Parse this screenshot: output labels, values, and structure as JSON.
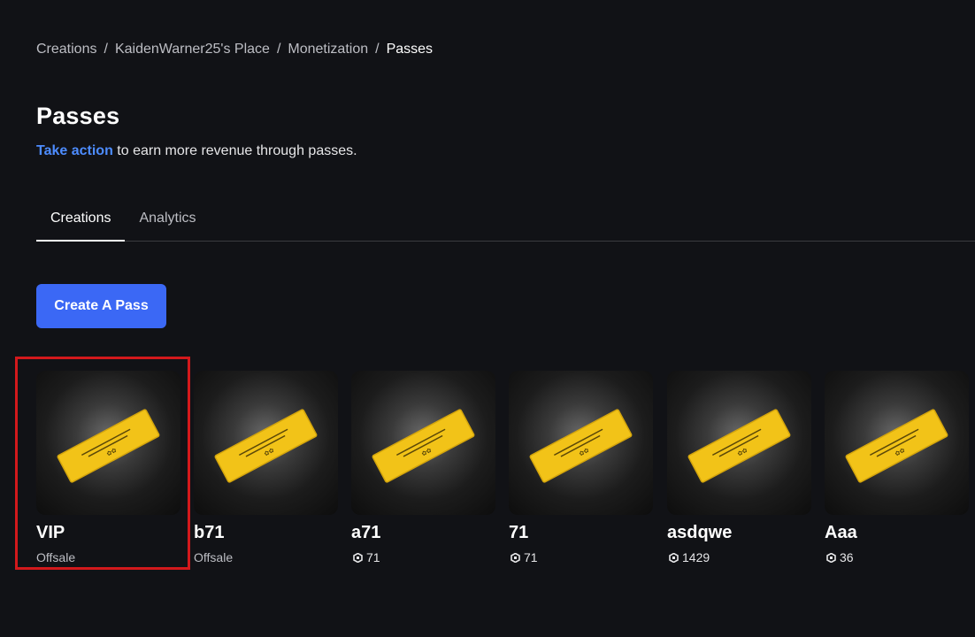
{
  "breadcrumb": {
    "items": [
      "Creations",
      "KaidenWarner25's Place",
      "Monetization"
    ],
    "current": "Passes",
    "separator": "/"
  },
  "header": {
    "title": "Passes",
    "subtitle_link": "Take action",
    "subtitle_rest": " to earn more revenue through passes."
  },
  "tabs": [
    {
      "label": "Creations",
      "active": true
    },
    {
      "label": "Analytics",
      "active": false
    }
  ],
  "create_button": "Create A Pass",
  "passes": [
    {
      "name": "VIP",
      "status": "Offsale",
      "icon": "pass-ticket-icon",
      "selected": true
    },
    {
      "name": "b71",
      "status": "Offsale",
      "icon": "pass-ticket-icon"
    },
    {
      "name": "a71",
      "price": "71",
      "icon": "pass-ticket-icon"
    },
    {
      "name": "71",
      "price": "71",
      "icon": "pass-ticket-icon"
    },
    {
      "name": "asdqwe",
      "price": "1429",
      "icon": "pass-ticket-icon"
    },
    {
      "name": "Aaa",
      "price": "36",
      "icon": "pass-ticket-icon"
    }
  ],
  "colors": {
    "background": "#111216",
    "accent": "#3b68f5",
    "link": "#4d8cff",
    "highlight": "#d3191c",
    "ticket": "#f2c318"
  }
}
